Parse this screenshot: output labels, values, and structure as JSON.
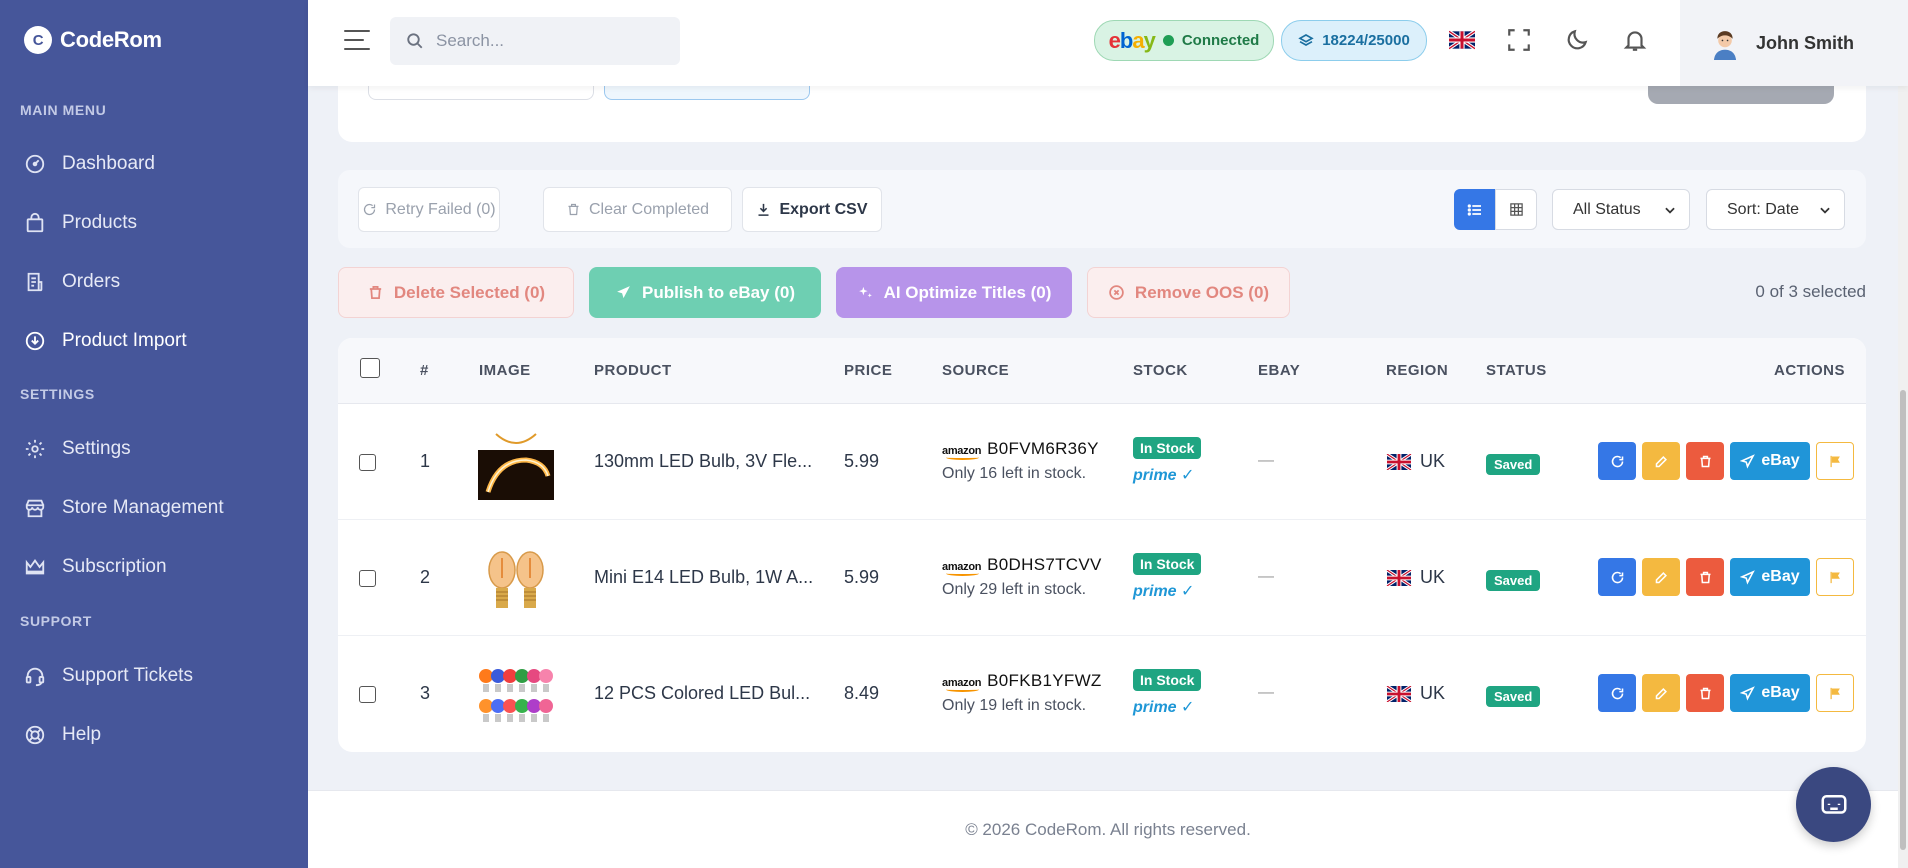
{
  "app": {
    "brand": "CodeRom",
    "logo_mark": "C"
  },
  "sidebar": {
    "sections": [
      {
        "title": "MAIN MENU"
      },
      {
        "title": "SETTINGS"
      },
      {
        "title": "SUPPORT"
      }
    ],
    "items": [
      {
        "label": "Dashboard",
        "icon": "gauge-icon"
      },
      {
        "label": "Products",
        "icon": "shopping-bag-icon"
      },
      {
        "label": "Orders",
        "icon": "receipt-icon"
      },
      {
        "label": "Product Import",
        "icon": "cloud-download-icon",
        "active": true
      },
      {
        "label": "Settings",
        "icon": "gear-icon"
      },
      {
        "label": "Store Management",
        "icon": "store-icon"
      },
      {
        "label": "Subscription",
        "icon": "crown-icon"
      },
      {
        "label": "Support Tickets",
        "icon": "headset-icon"
      },
      {
        "label": "Help",
        "icon": "lifebuoy-icon"
      }
    ]
  },
  "topbar": {
    "search_placeholder": "Search...",
    "ebay_status": "Connected",
    "credits": "18224/25000",
    "user_name": "John Smith"
  },
  "toolbar": {
    "retry_failed": "Retry Failed (0)",
    "clear_completed": "Clear Completed",
    "export_csv": "Export CSV",
    "status_filter": "All Status",
    "sort": "Sort: Date"
  },
  "bulk_actions": {
    "delete": "Delete Selected (0)",
    "publish": "Publish to eBay (0)",
    "ai_optimize": "AI Optimize Titles (0)",
    "remove_oos": "Remove OOS (0)",
    "selection_count": "0 of 3 selected"
  },
  "table": {
    "headers": [
      "#",
      "IMAGE",
      "PRODUCT",
      "PRICE",
      "SOURCE",
      "STOCK",
      "EBAY",
      "REGION",
      "STATUS",
      "ACTIONS"
    ],
    "rows": [
      {
        "num": "1",
        "product": "130mm LED Bulb, 3V Fle...",
        "price": "5.99",
        "asin": "B0FVM6R36Y",
        "stock_left": "Only 16 left in stock.",
        "stock": "In Stock",
        "prime": "prime ✓",
        "ebay": "—",
        "region": "UK",
        "status": "Saved",
        "ebay_btn": "eBay"
      },
      {
        "num": "2",
        "product": "Mini E14 LED Bulb, 1W A...",
        "price": "5.99",
        "asin": "B0DHS7TCVV",
        "stock_left": "Only 29 left in stock.",
        "stock": "In Stock",
        "prime": "prime ✓",
        "ebay": "—",
        "region": "UK",
        "status": "Saved",
        "ebay_btn": "eBay"
      },
      {
        "num": "3",
        "product": "12 PCS Colored LED Bul...",
        "price": "8.49",
        "asin": "B0FKB1YFWZ",
        "stock_left": "Only 19 left in stock.",
        "stock": "In Stock",
        "prime": "prime ✓",
        "ebay": "—",
        "region": "UK",
        "status": "Saved",
        "ebay_btn": "eBay"
      }
    ],
    "source_brand": "amazon"
  },
  "footer": {
    "text": "© 2026 CodeRom. All rights reserved."
  },
  "colors": {
    "sidebar": "#46569a",
    "accent_blue": "#3577e6",
    "success": "#1fa582",
    "warning": "#f4b940",
    "danger": "#ec5b3e",
    "ebay_blue": "#2095d8"
  }
}
